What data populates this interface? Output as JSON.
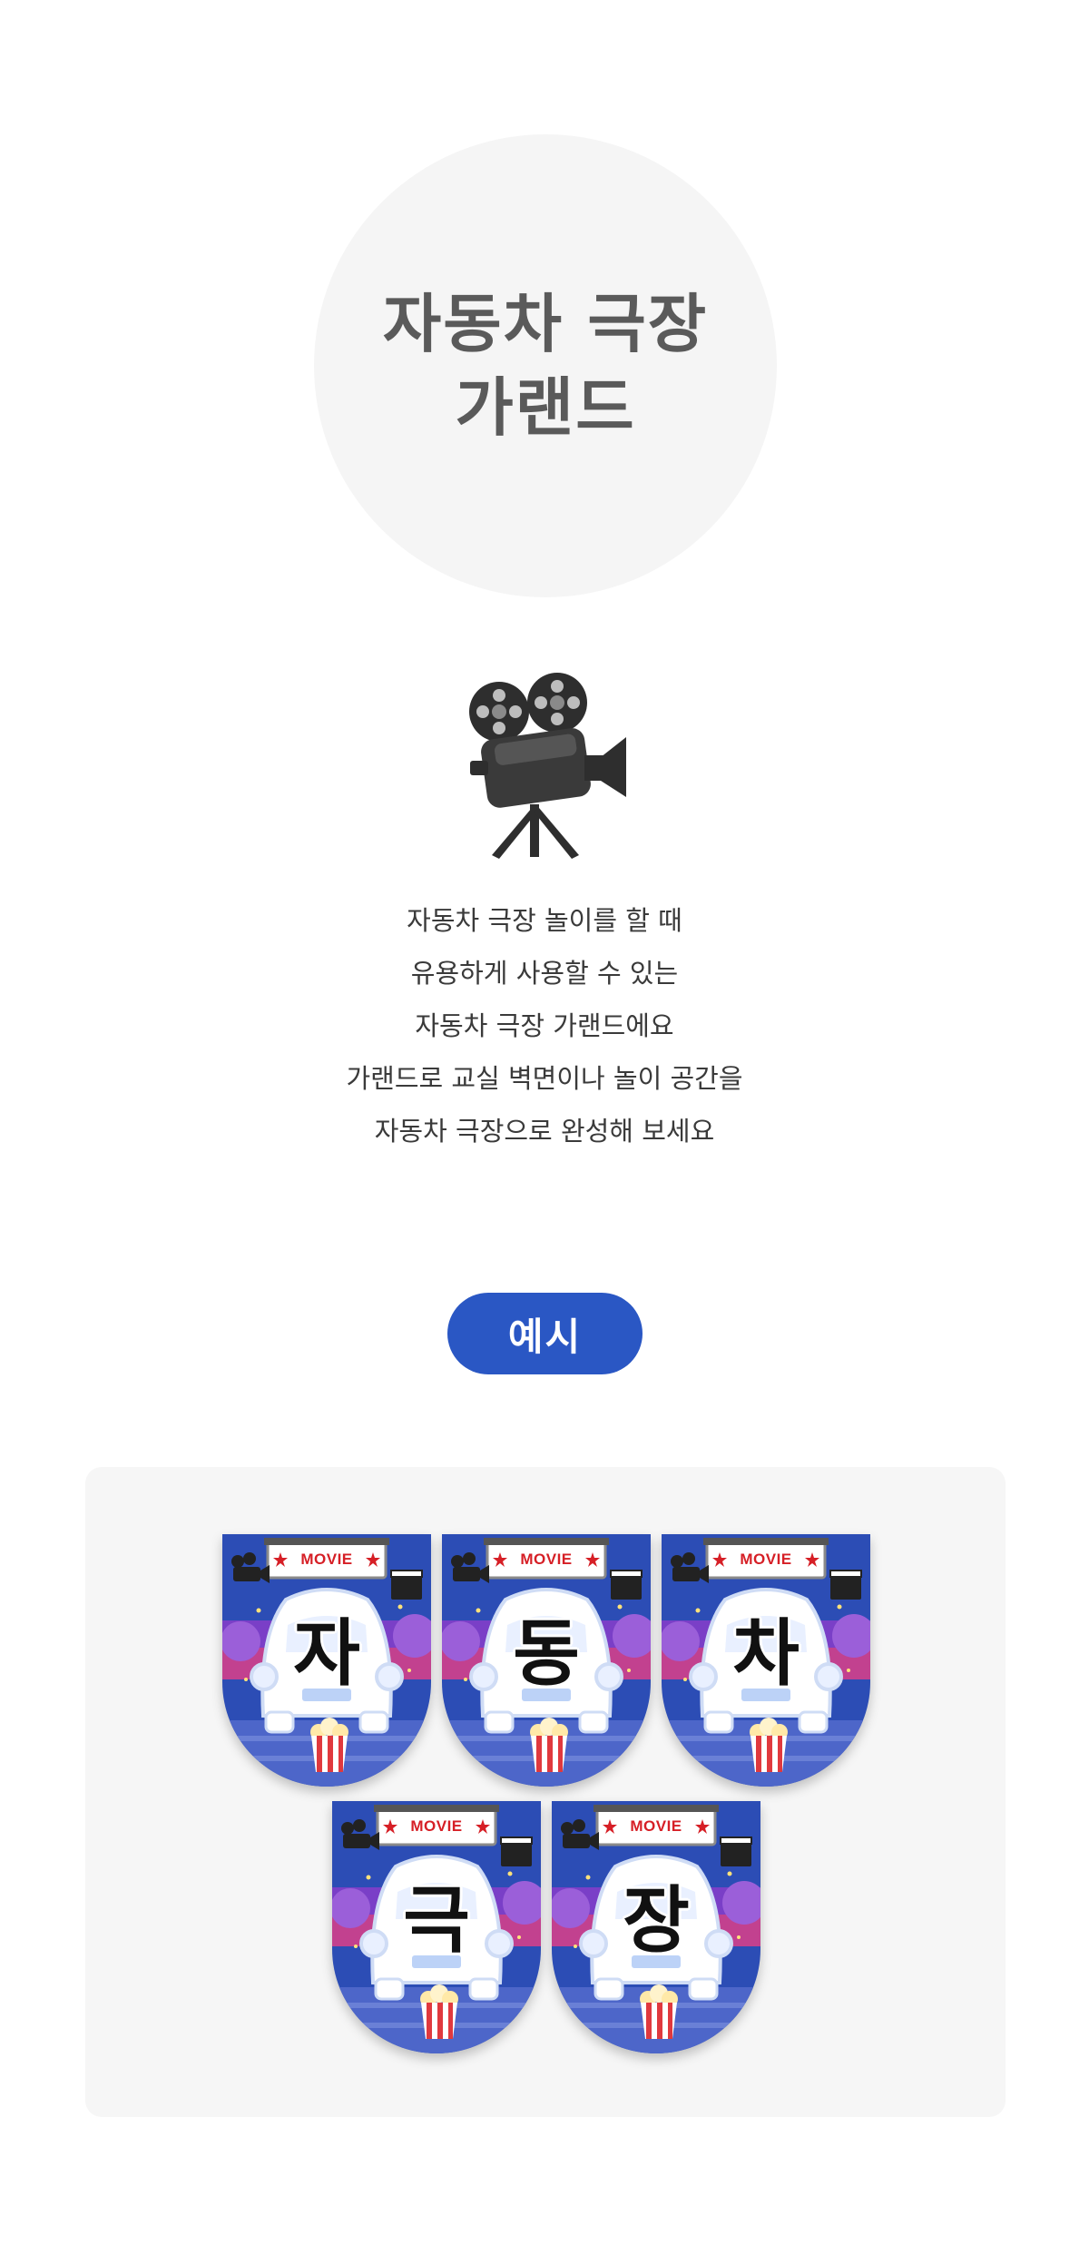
{
  "hero": {
    "title_line1": "자동차 극장",
    "title_line2": "가랜드"
  },
  "icon": {
    "name": "movie-camera-icon"
  },
  "description": {
    "lines": [
      "자동차 극장 놀이를 할 때",
      "유용하게 사용할 수 있는",
      "자동차 극장 가랜드에요",
      "가랜드로 교실 벽면이나 놀이 공간을",
      "자동차 극장으로 완성해 보세요"
    ]
  },
  "example": {
    "label": "예시"
  },
  "garland": {
    "sign_text": "MOVIE",
    "letters": [
      "자",
      "동",
      "차",
      "극",
      "장"
    ]
  },
  "colors": {
    "accent": "#2a57c4",
    "title": "#5a5a5a",
    "circle_bg": "#f5f5f5",
    "panel_bg": "#f6f6f6",
    "pennant_bg": "#2c4db5",
    "pennant_band": "#7a3fc7",
    "sign_red": "#d61f26"
  }
}
